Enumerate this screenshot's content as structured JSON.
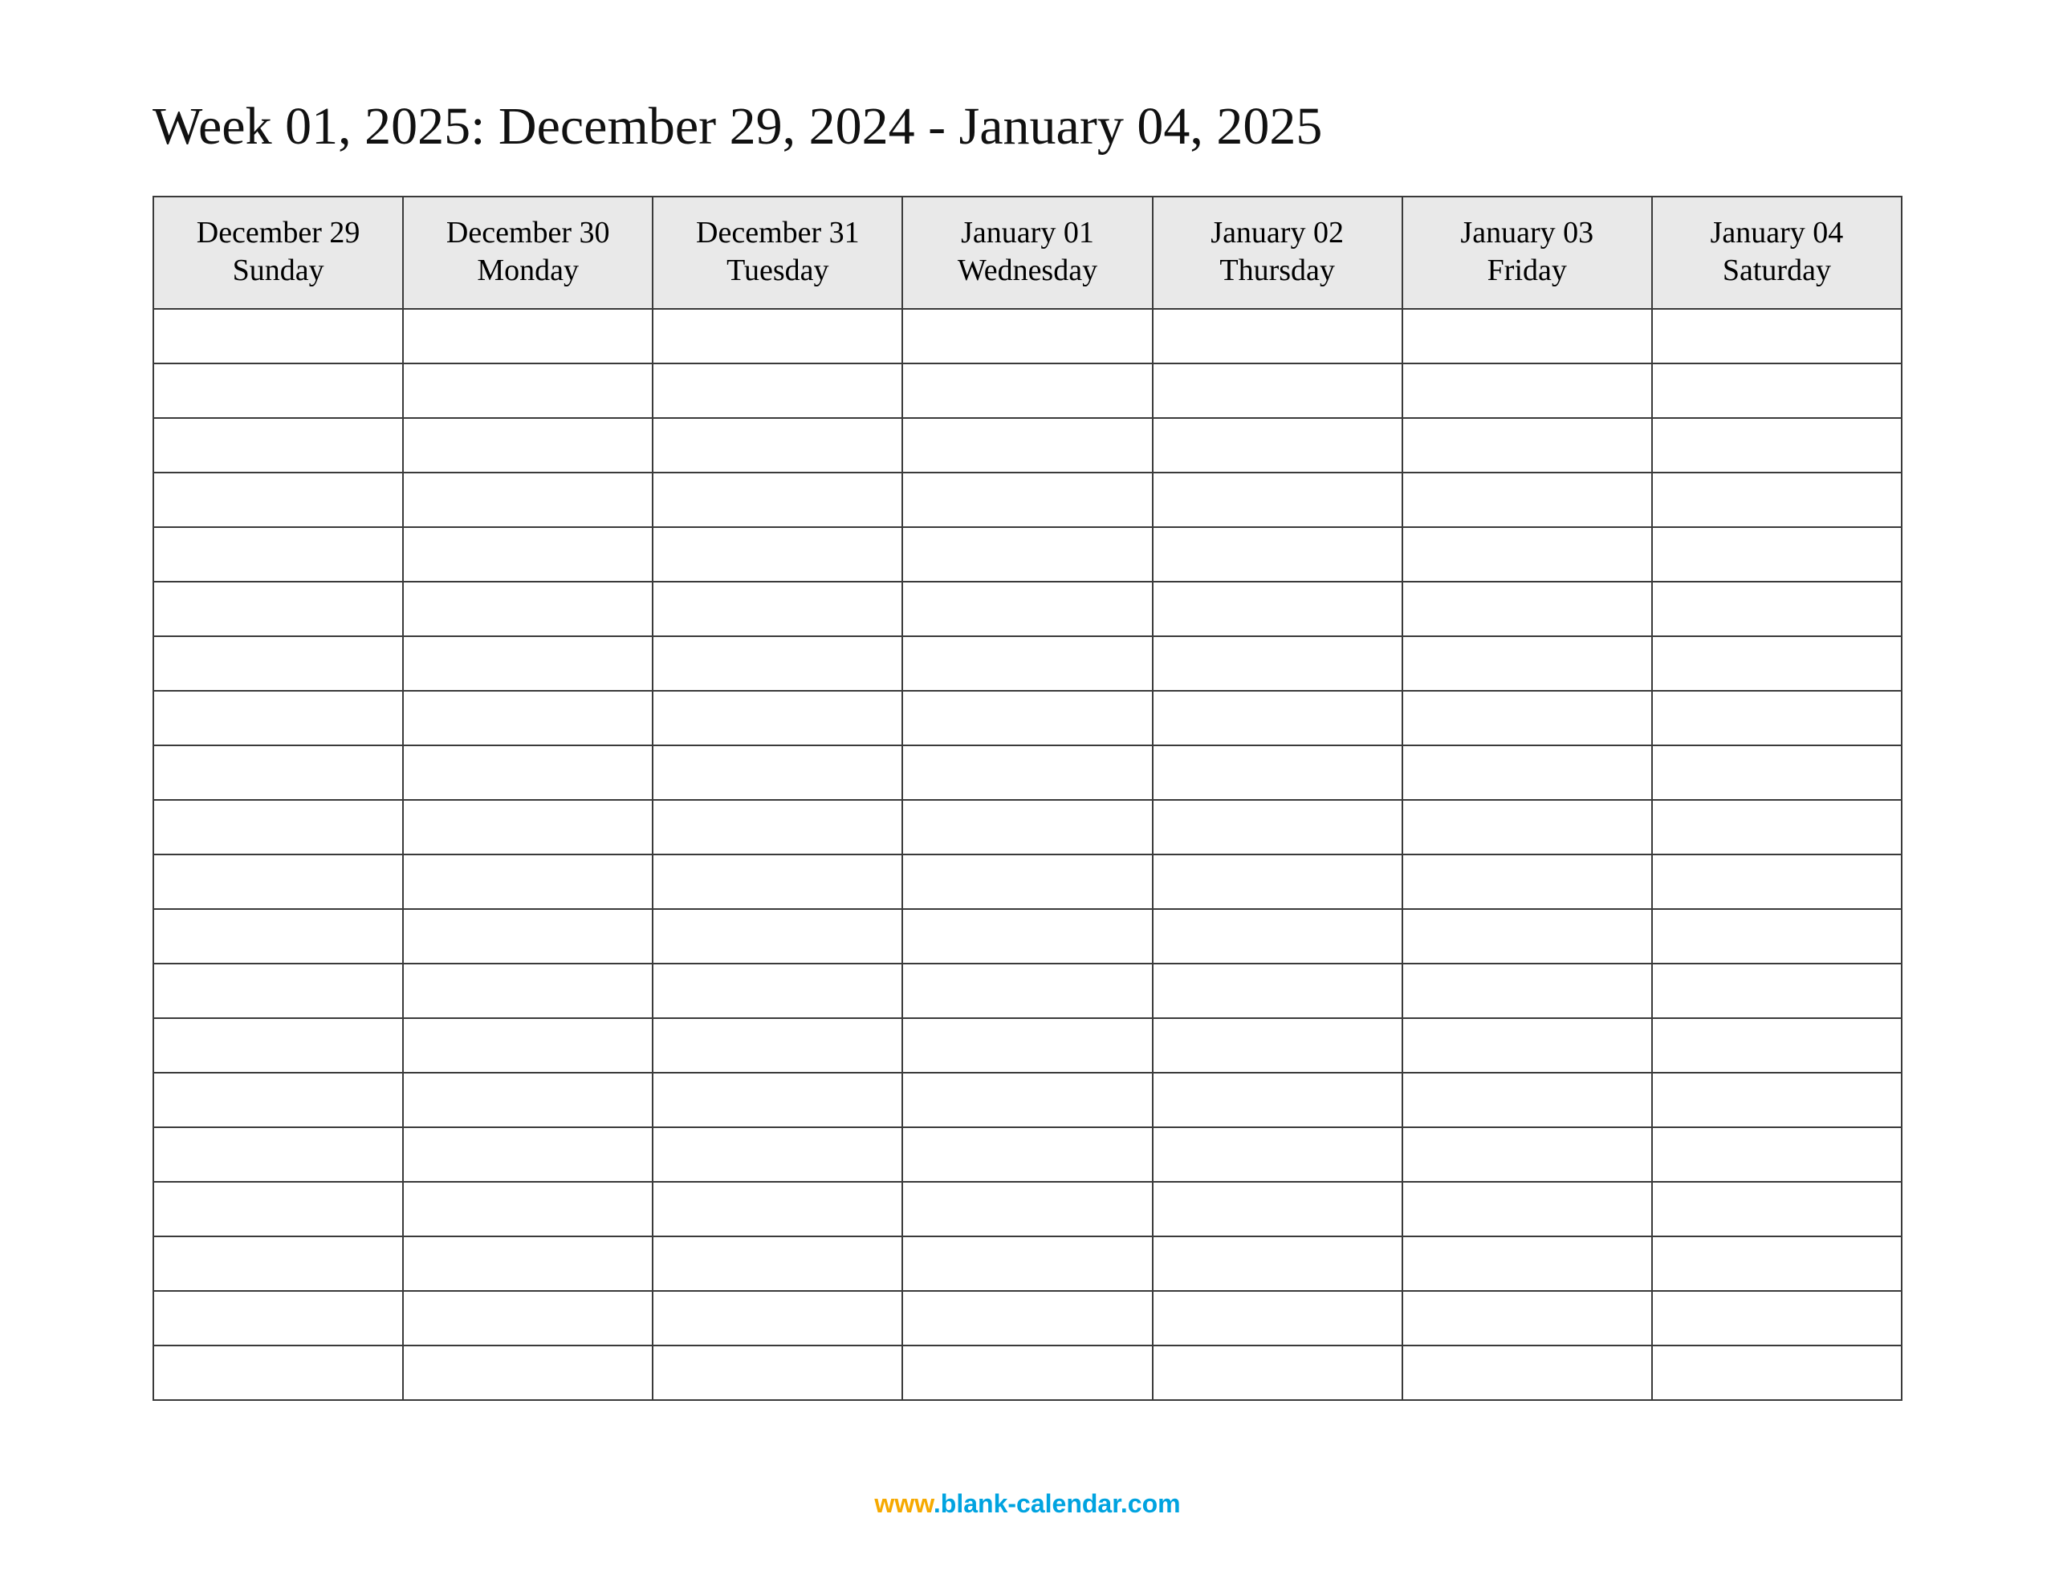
{
  "title": "Week 01, 2025: December 29, 2024 - January 04, 2025",
  "columns": [
    {
      "date": "December 29",
      "day": "Sunday"
    },
    {
      "date": "December 30",
      "day": "Monday"
    },
    {
      "date": "December 31",
      "day": "Tuesday"
    },
    {
      "date": "January 01",
      "day": "Wednesday"
    },
    {
      "date": "January 02",
      "day": "Thursday"
    },
    {
      "date": "January 03",
      "day": "Friday"
    },
    {
      "date": "January 04",
      "day": "Saturday"
    }
  ],
  "row_count": 20,
  "footer": {
    "www": "www",
    "domain": ".blank-calendar.com"
  }
}
